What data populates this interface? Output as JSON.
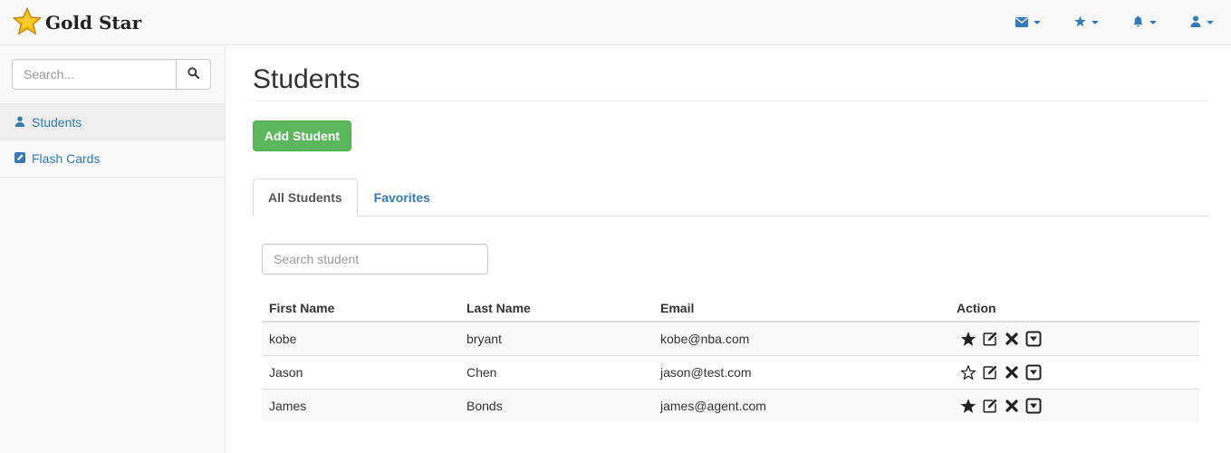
{
  "app": {
    "brand": "Gold Star"
  },
  "navbar": {
    "icons": [
      "envelope-icon",
      "star-icon",
      "bell-icon",
      "user-icon"
    ],
    "accent": "#337ab7"
  },
  "sidebar": {
    "search_placeholder": "Search...",
    "items": [
      {
        "label": "Students",
        "icon": "user-icon"
      },
      {
        "label": "Flash Cards",
        "icon": "edit-icon"
      }
    ]
  },
  "main": {
    "title": "Students",
    "add_button": "Add Student",
    "tabs": [
      {
        "label": "All Students",
        "active": true
      },
      {
        "label": "Favorites",
        "active": false
      }
    ],
    "student_search_placeholder": "Search student",
    "table": {
      "columns": [
        "First Name",
        "Last Name",
        "Email",
        "Action"
      ],
      "rows": [
        {
          "first": "kobe",
          "last": "bryant",
          "email": "kobe@nba.com",
          "favorite": true
        },
        {
          "first": "Jason",
          "last": "Chen",
          "email": "jason@test.com",
          "favorite": false
        },
        {
          "first": "James",
          "last": "Bonds",
          "email": "james@agent.com",
          "favorite": true
        }
      ]
    }
  },
  "colors": {
    "success": "#5cb85c",
    "link": "#337ab7",
    "star": "#f5b700"
  }
}
